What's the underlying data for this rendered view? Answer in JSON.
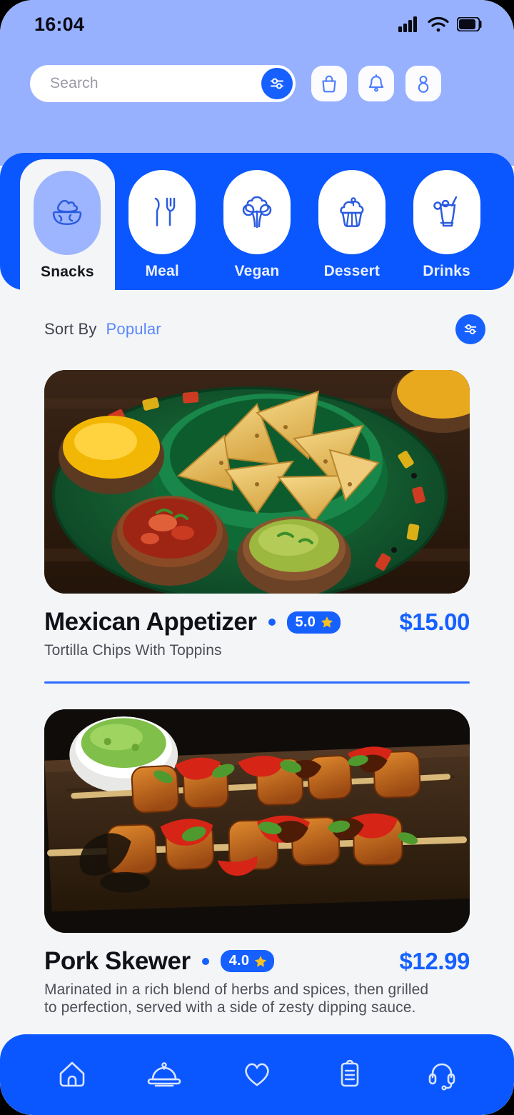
{
  "status_bar": {
    "time": "16:04",
    "icons": [
      "signal-icon",
      "wifi-icon",
      "battery-icon"
    ]
  },
  "header": {
    "search": {
      "placeholder": "Search",
      "value": "",
      "filter_icon": "sliders-icon"
    },
    "actions": [
      {
        "name": "shopping-bag-button",
        "icon": "shopping-bag-icon"
      },
      {
        "name": "notifications-button",
        "icon": "bell-icon"
      },
      {
        "name": "profile-button",
        "icon": "user-icon"
      }
    ],
    "background_color": "#97B1FF"
  },
  "categories": {
    "active": "Snacks",
    "band_color": "#0B57FF",
    "items": [
      {
        "label": "Snacks",
        "icon": "snack-bowl-icon",
        "active": true
      },
      {
        "label": "Meal",
        "icon": "cutlery-icon",
        "active": false
      },
      {
        "label": "Vegan",
        "icon": "broccoli-icon",
        "active": false
      },
      {
        "label": "Dessert",
        "icon": "cupcake-icon",
        "active": false
      },
      {
        "label": "Drinks",
        "icon": "drink-glass-icon",
        "active": false
      }
    ]
  },
  "sort": {
    "label": "Sort By",
    "value": "Popular",
    "filter_icon": "sliders-icon"
  },
  "items": [
    {
      "title": "Mexican Appetizer",
      "rating": "5.0",
      "price": "$15.00",
      "description": "Tortilla Chips With Toppins",
      "image_alt": "tortilla chips in green bowl with salsa, guacamole and cheese dips"
    },
    {
      "title": "Pork Skewer",
      "rating": "4.0",
      "price": "$12.99",
      "description": "Marinated in a rich blend of herbs and spices, then grilled to perfection, served with a side of zesty dipping sauce.",
      "image_alt": "two glazed pork skewers with red peppers on a dark wooden board"
    }
  ],
  "bottom_nav": {
    "background_color": "#0B57FF",
    "items": [
      {
        "name": "nav-home",
        "icon": "home-icon"
      },
      {
        "name": "nav-menu",
        "icon": "food-dome-icon"
      },
      {
        "name": "nav-favorites",
        "icon": "heart-icon"
      },
      {
        "name": "nav-orders",
        "icon": "clipboard-icon"
      },
      {
        "name": "nav-support",
        "icon": "headset-icon"
      }
    ]
  },
  "colors": {
    "brand_blue": "#1560FF",
    "band_blue": "#0B57FF",
    "header_blue": "#97B1FF",
    "content_bg": "#F4F5F7",
    "star_gold": "#F5C024"
  }
}
